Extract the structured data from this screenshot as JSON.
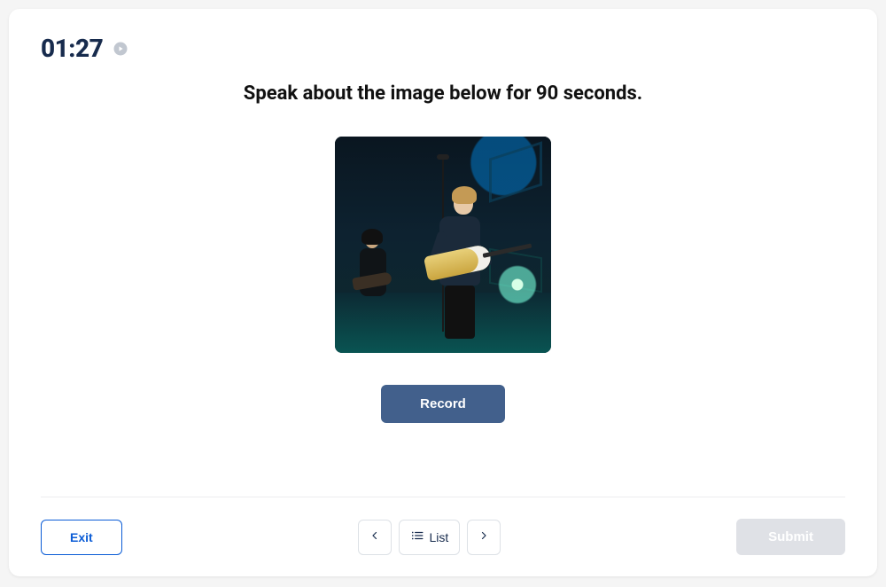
{
  "timer": "01:27",
  "instruction": "Speak about the image below for 90 seconds.",
  "image": {
    "alt": "concert-photo-guitarist-singing"
  },
  "buttons": {
    "record": "Record",
    "exit": "Exit",
    "list": "List",
    "submit": "Submit"
  }
}
